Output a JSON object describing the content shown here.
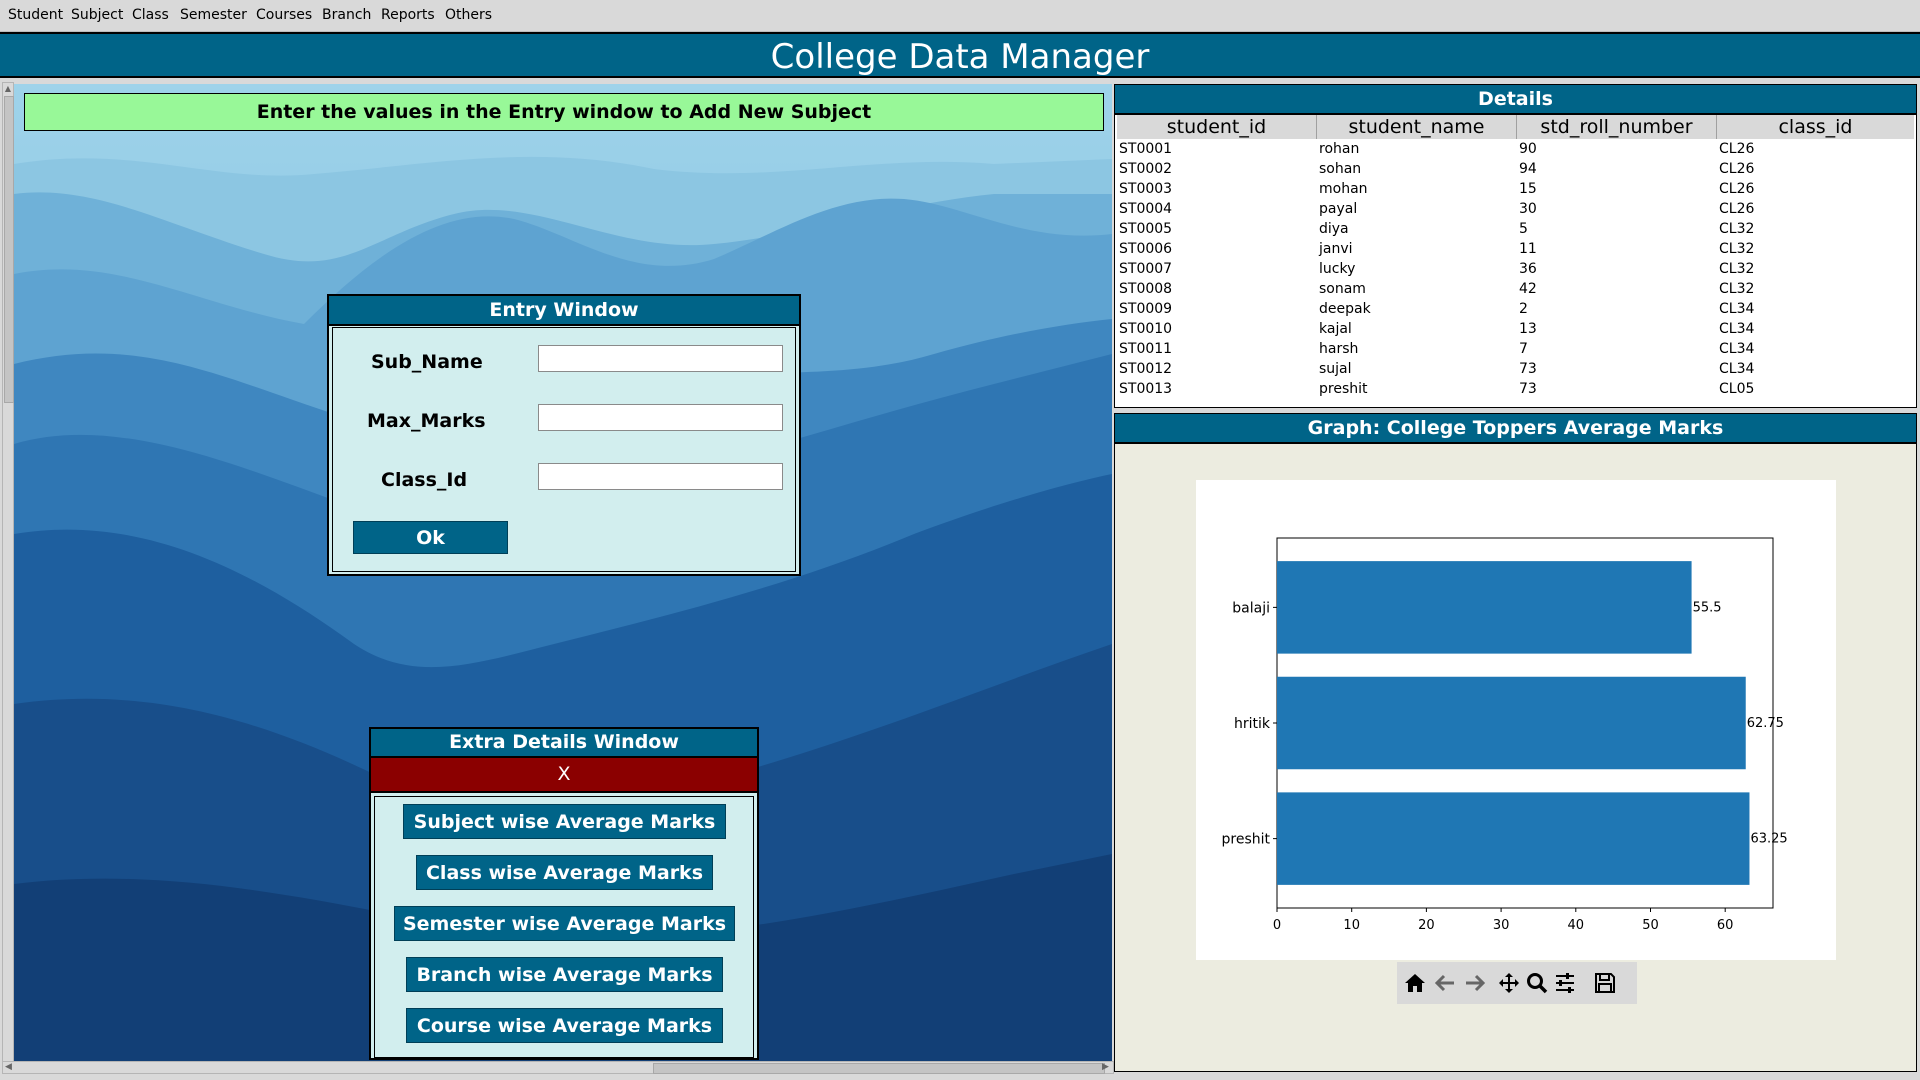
{
  "menu": [
    "Student",
    "Subject",
    "Class",
    "Semester",
    "Courses",
    "Branch",
    "Reports",
    "Others"
  ],
  "app_title": "College Data Manager",
  "banner": "Enter the values in the Entry window to Add New Subject",
  "entry_window": {
    "title": "Entry Window",
    "fields": [
      {
        "label": "Sub_Name",
        "value": ""
      },
      {
        "label": "Max_Marks",
        "value": ""
      },
      {
        "label": "Class_Id",
        "value": ""
      }
    ],
    "ok_label": "Ok"
  },
  "extra_window": {
    "title": "Extra Details Window",
    "close_label": "X",
    "buttons": [
      "Subject wise Average Marks",
      "Class wise Average Marks",
      "Semester wise Average Marks",
      "Branch wise Average Marks",
      "Course wise Average Marks"
    ]
  },
  "details": {
    "title": "Details",
    "columns": [
      "student_id",
      "student_name",
      "std_roll_number",
      "class_id"
    ],
    "rows": [
      [
        "ST0001",
        "rohan",
        "90",
        "CL26"
      ],
      [
        "ST0002",
        "sohan",
        "94",
        "CL26"
      ],
      [
        "ST0003",
        "mohan",
        "15",
        "CL26"
      ],
      [
        "ST0004",
        "payal",
        "30",
        "CL26"
      ],
      [
        "ST0005",
        "diya",
        "5",
        "CL32"
      ],
      [
        "ST0006",
        "janvi",
        "11",
        "CL32"
      ],
      [
        "ST0007",
        "lucky",
        "36",
        "CL32"
      ],
      [
        "ST0008",
        "sonam",
        "42",
        "CL32"
      ],
      [
        "ST0009",
        "deepak",
        "2",
        "CL34"
      ],
      [
        "ST0010",
        "kajal",
        "13",
        "CL34"
      ],
      [
        "ST0011",
        "harsh",
        "7",
        "CL34"
      ],
      [
        "ST0012",
        "sujal",
        "73",
        "CL34"
      ],
      [
        "ST0013",
        "preshit",
        "73",
        "CL05"
      ]
    ]
  },
  "graph": {
    "title": "Graph: College Toppers Average Marks",
    "toolbar_icons": [
      "home-icon",
      "back-arrow-icon",
      "forward-arrow-icon",
      "pan-icon",
      "zoom-icon",
      "configure-icon",
      "save-icon"
    ]
  },
  "chart_data": {
    "type": "bar",
    "orientation": "horizontal",
    "categories": [
      "balaji",
      "hritik",
      "preshit"
    ],
    "values": [
      55.5,
      62.75,
      63.25
    ],
    "value_labels": [
      "55.5",
      "62.75",
      "63.25"
    ],
    "xlim": [
      0,
      66.4
    ],
    "xticks": [
      0,
      10,
      20,
      30,
      40,
      50,
      60
    ],
    "bar_color": "#1f77b4",
    "title": "",
    "xlabel": "",
    "ylabel": ""
  }
}
